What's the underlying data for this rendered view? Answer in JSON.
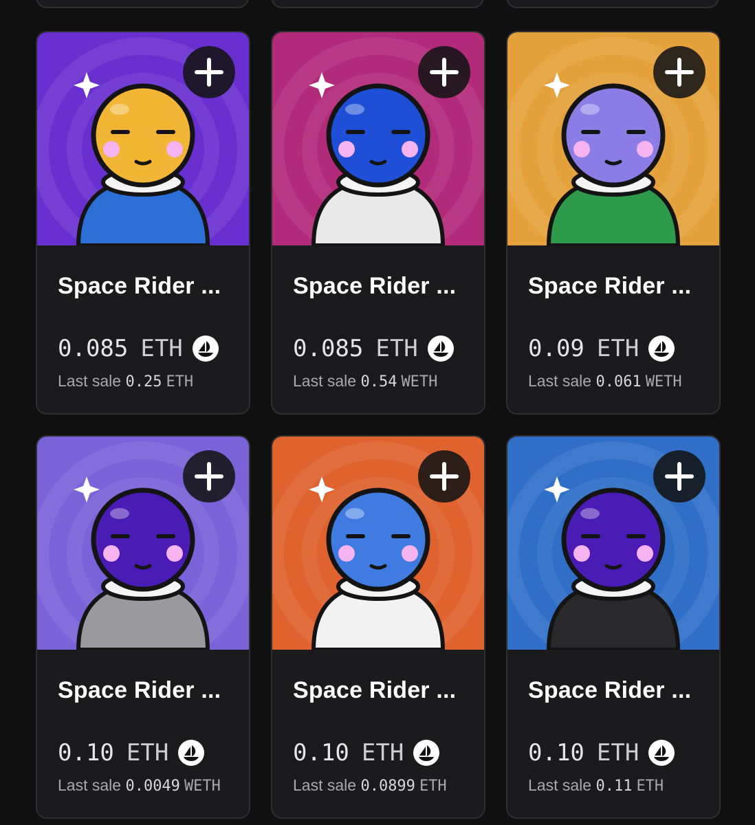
{
  "cards": [
    {
      "name": "Space Rider ...",
      "price": "0.085",
      "unit": "ETH",
      "last_sale_label": "Last sale",
      "last_sale_value": "0.25",
      "last_sale_unit": "ETH",
      "bg": "#6a2fd0",
      "helmet": "#f2b634",
      "accent": "#2c6fd6"
    },
    {
      "name": "Space Rider ...",
      "price": "0.085",
      "unit": "ETH",
      "last_sale_label": "Last sale",
      "last_sale_value": "0.54",
      "last_sale_unit": "WETH",
      "bg": "#b22a7a",
      "helmet": "#1f4fd6",
      "accent": "#e9e9ea"
    },
    {
      "name": "Space Rider ...",
      "price": "0.09",
      "unit": "ETH",
      "last_sale_label": "Last sale",
      "last_sale_value": "0.061",
      "last_sale_unit": "WETH",
      "bg": "#e5a13b",
      "helmet": "#8c7de6",
      "accent": "#2e9a4c"
    },
    {
      "name": "Space Rider ...",
      "price": "0.10",
      "unit": "ETH",
      "last_sale_label": "Last sale",
      "last_sale_value": "0.0049",
      "last_sale_unit": "WETH",
      "bg": "#7a62d8",
      "helmet": "#4b1bb5",
      "accent": "#9a9a9e"
    },
    {
      "name": "Space Rider ...",
      "price": "0.10",
      "unit": "ETH",
      "last_sale_label": "Last sale",
      "last_sale_value": "0.0899",
      "last_sale_unit": "ETH",
      "bg": "#e0622e",
      "helmet": "#3f7be0",
      "accent": "#f2f2f2"
    },
    {
      "name": "Space Rider ...",
      "price": "0.10",
      "unit": "ETH",
      "last_sale_label": "Last sale",
      "last_sale_value": "0.11",
      "last_sale_unit": "ETH",
      "bg": "#2f6fc8",
      "helmet": "#4b1bb5",
      "accent": "#2a2a2c"
    }
  ],
  "add_button_label": "+"
}
